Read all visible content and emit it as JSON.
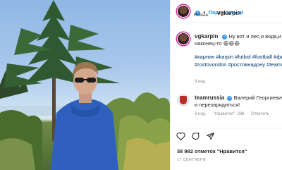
{
  "post": {
    "username": "vgkarpin",
    "follow_label": "Подписаться",
    "location": "Russia",
    "caption_username": "vgkarpin",
    "caption_text": "Ну вот и лес,и вода,и всё... добрался наконец-то 😄😄😄",
    "hashtags": "#карпин #karpin #futbol #football #фкростов #fcrostov #rostovondon #ростовнадону #teamrussia #москва",
    "caption_time": "8 нед.",
    "comment": {
      "username": "teamrussia",
      "text": "Валерий Георгиевич, хорошо отдохнуть и перезарядиться!",
      "time": "6 нед.",
      "likes": "\"Нравится\": 388",
      "reply_label": "Ответить"
    },
    "likes": "38 982 отметок \"Нравится\"",
    "date": "17 СЕНТЯБРЯ"
  },
  "icons": {
    "like": "heart-icon",
    "comment": "comment-icon",
    "share": "paper-plane-icon",
    "verified": "verified-badge-icon"
  },
  "colors": {
    "link": "#00376b",
    "follow": "#0095f6",
    "muted": "#8e8e8e",
    "verified": "#3897f0"
  }
}
